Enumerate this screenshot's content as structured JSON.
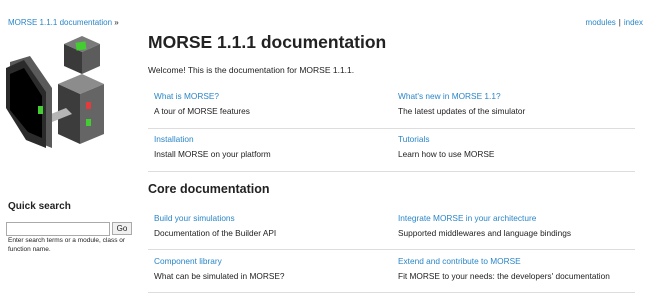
{
  "topbar": {
    "breadcrumb": "MORSE 1.1.1 documentation",
    "breadcrumb_sep": "»",
    "modules": "modules",
    "pipe": "|",
    "index": "index"
  },
  "sidebar": {
    "quick_search_title": "Quick search",
    "search_value": "",
    "go_label": "Go",
    "help_text": "Enter search terms or a module, class or function name."
  },
  "main": {
    "title": "MORSE 1.1.1 documentation",
    "welcome": "Welcome! This is the documentation for MORSE 1.1.1.",
    "intro_cells": [
      {
        "link": "What is MORSE?",
        "desc": "A tour of MORSE features"
      },
      {
        "link": "What's new in MORSE 1.1?",
        "desc": "The latest updates of the simulator"
      },
      {
        "link": "Installation",
        "desc": "Install MORSE on your platform"
      },
      {
        "link": "Tutorials",
        "desc": "Learn how to use MORSE"
      }
    ],
    "core_title": "Core documentation",
    "core_cells": [
      {
        "link": "Build your simulations",
        "desc": "Documentation of the Builder API"
      },
      {
        "link": "Integrate MORSE in your architecture",
        "desc": "Supported middlewares and language bindings"
      },
      {
        "link": "Component library",
        "desc": "What can be simulated in MORSE?"
      },
      {
        "link": "Extend and contribute to MORSE",
        "desc": "Fit MORSE to your needs: the developers' documentation"
      }
    ]
  }
}
